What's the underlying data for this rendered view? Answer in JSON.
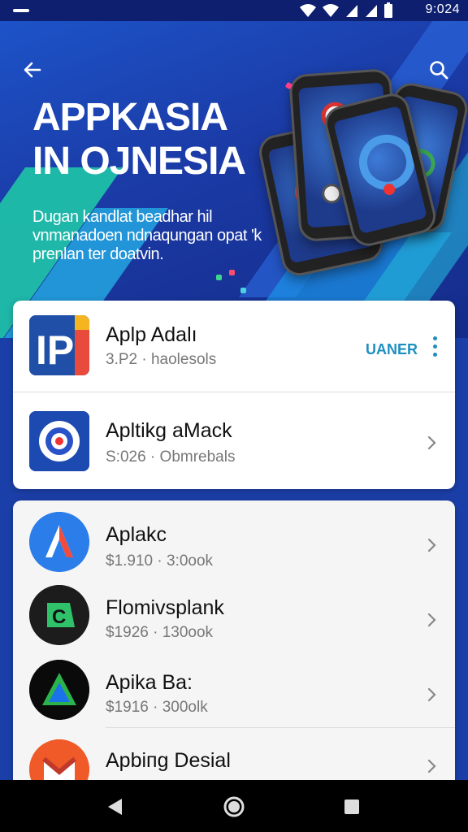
{
  "status_bar": {
    "time": "9:024"
  },
  "hero": {
    "title_lines": [
      "APPKASIA",
      "IN OJNESIA"
    ],
    "subtitle_lines": [
      "Dugan kandlat beadhar hil",
      "vnmanadoen ndnaqungan opat 'k",
      "prenlan ter doatvin."
    ]
  },
  "featured": [
    {
      "name": "Aplp Adalı",
      "meta": "3.P2 · haolesols",
      "action": "UANER",
      "icon": "ip-app-icon"
    },
    {
      "name": "Apltikg aMack",
      "meta": "S:026 · Obmrebals",
      "icon": "target-app-icon"
    }
  ],
  "apps": [
    {
      "name": "Aplakc",
      "meta": "$1.910 · 3:0ook",
      "icon": "a-app-icon"
    },
    {
      "name": "Flomivsplank",
      "meta": "$1926 · 130ook",
      "icon": "c-app-icon"
    },
    {
      "name": "Apika Ba:",
      "meta": "$1916 · 300olk",
      "icon": "triangle-app-icon"
    },
    {
      "name": "Apbiпg Desial",
      "meta": "",
      "icon": "m-app-icon"
    }
  ],
  "colors": {
    "hero_blue": "#1b3fa8",
    "accent": "#1e8fc0",
    "nav": "#000000"
  }
}
